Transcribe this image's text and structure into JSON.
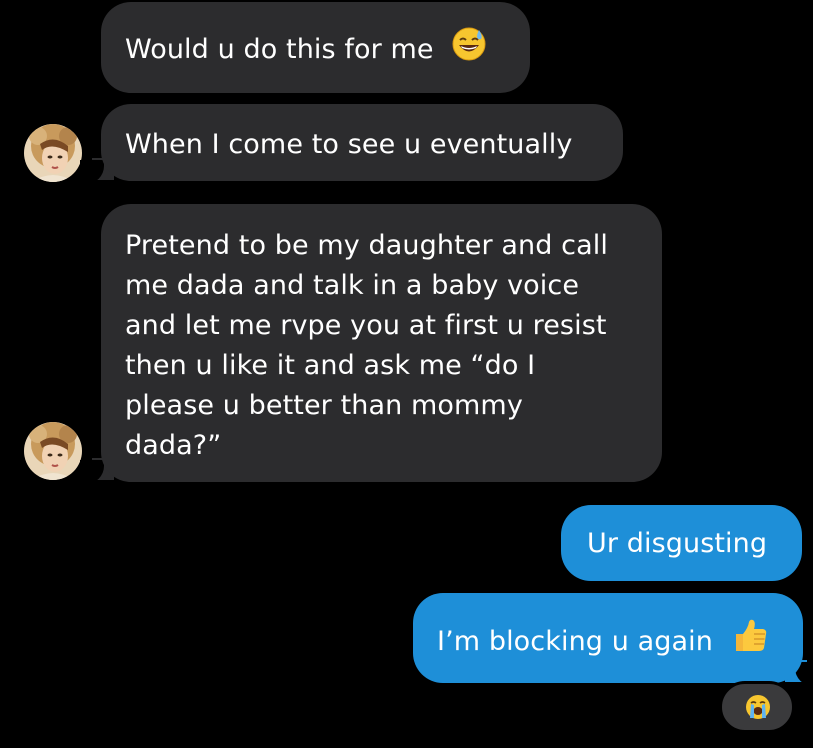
{
  "messages": {
    "m1": {
      "text": "Would u do this for me",
      "emoji": "sweat-smile-emoji"
    },
    "m2": {
      "text": "When I come to see u eventually"
    },
    "m3": {
      "lines": [
        "Pretend to be my daughter and call",
        "me dada and talk in a baby voice",
        "and let me rvpe you at first u resist",
        "then u like it and ask me “do I",
        "please u better than mommy",
        "dada?”"
      ]
    },
    "m4": {
      "text": "Ur disgusting"
    },
    "m5": {
      "text": "I’m blocking u again",
      "emoji": "thumbs-up-emoji"
    }
  },
  "reaction": {
    "emoji": "loudly-crying-face-emoji"
  },
  "colors": {
    "background": "#000000",
    "incoming_bubble": "#2c2c2e",
    "outgoing_bubble": "#1e8fd8",
    "text": "#ffffff",
    "reaction_bubble": "#3a3a3c"
  }
}
